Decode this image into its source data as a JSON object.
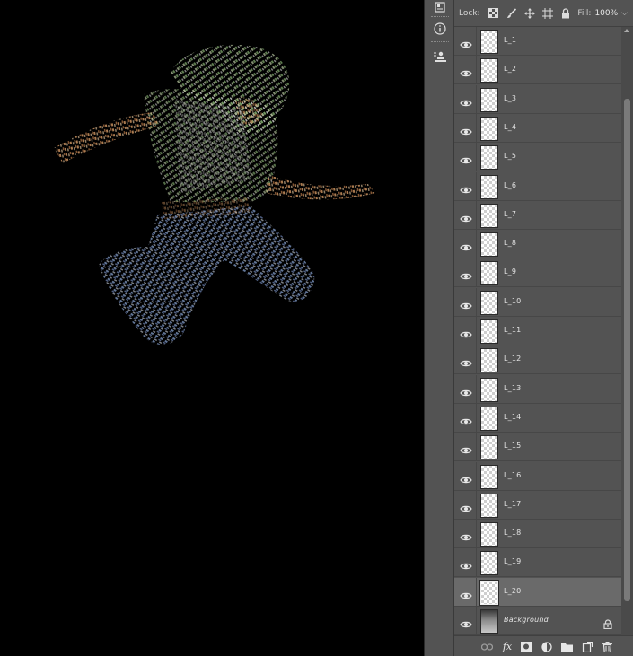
{
  "lockbar": {
    "lock_label": "Lock:",
    "fill_label": "Fill:",
    "fill_value": "100%",
    "icons": [
      "lock-transparent-pixels-icon",
      "lock-image-pixels-icon",
      "lock-position-icon",
      "lock-artboard-icon",
      "lock-all-icon"
    ]
  },
  "toolstrip": {
    "icons": [
      "properties-icon",
      "info-icon",
      "clone-source-icon"
    ]
  },
  "layers": [
    {
      "name": "L_1",
      "visible": true,
      "selected": false
    },
    {
      "name": "L_2",
      "visible": true,
      "selected": false
    },
    {
      "name": "L_3",
      "visible": true,
      "selected": false
    },
    {
      "name": "L_4",
      "visible": true,
      "selected": false
    },
    {
      "name": "L_5",
      "visible": true,
      "selected": false
    },
    {
      "name": "L_6",
      "visible": true,
      "selected": false
    },
    {
      "name": "L_7",
      "visible": true,
      "selected": false
    },
    {
      "name": "L_8",
      "visible": true,
      "selected": false
    },
    {
      "name": "L_9",
      "visible": true,
      "selected": false
    },
    {
      "name": "L_10",
      "visible": true,
      "selected": false
    },
    {
      "name": "L_11",
      "visible": true,
      "selected": false
    },
    {
      "name": "L_12",
      "visible": true,
      "selected": false
    },
    {
      "name": "L_13",
      "visible": true,
      "selected": false
    },
    {
      "name": "L_14",
      "visible": true,
      "selected": false
    },
    {
      "name": "L_15",
      "visible": true,
      "selected": false
    },
    {
      "name": "L_16",
      "visible": true,
      "selected": false
    },
    {
      "name": "L_17",
      "visible": true,
      "selected": false
    },
    {
      "name": "L_18",
      "visible": true,
      "selected": false
    },
    {
      "name": "L_19",
      "visible": true,
      "selected": false
    },
    {
      "name": "L_20",
      "visible": true,
      "selected": true
    },
    {
      "name": "Background",
      "visible": true,
      "selected": false,
      "locked": true,
      "background": true
    }
  ],
  "footer": {
    "icons": [
      "link-layers-icon",
      "fx-icon",
      "layer-mask-icon",
      "adjustment-layer-icon",
      "new-group-icon",
      "new-layer-icon",
      "delete-layer-icon"
    ],
    "fx_label": "fx"
  },
  "colors": {
    "panel_bg": "#535353",
    "selected_row": "#6a6a6a",
    "canvas_bg": "#000000"
  }
}
